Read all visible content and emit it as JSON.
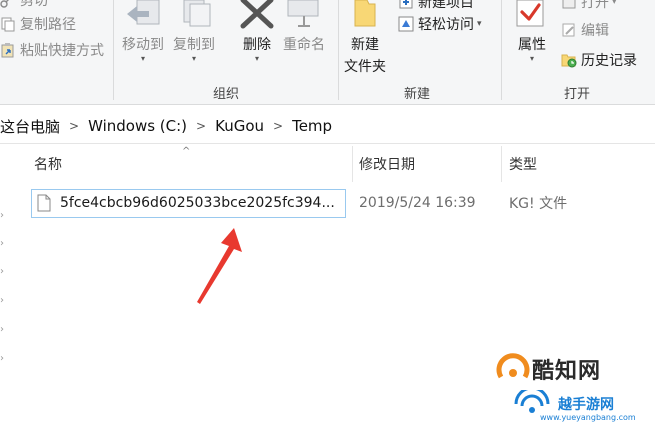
{
  "ribbon": {
    "clipboard": {
      "cut_label": "剪切",
      "copy_path_label": "复制路径",
      "paste_shortcut_label": "粘贴快捷方式"
    },
    "organize": {
      "move_to_label": "移动到",
      "copy_to_label": "复制到",
      "delete_label": "删除",
      "rename_label": "重命名",
      "group_label": "组织"
    },
    "new": {
      "new_folder_line1": "新建",
      "new_folder_line2": "文件夹",
      "new_item_label": "新建项目",
      "easy_access_label": "轻松访问",
      "group_label": "新建"
    },
    "open": {
      "properties_label": "属性",
      "open_label": "打开",
      "edit_label": "编辑",
      "history_label": "历史记录",
      "group_label": "打开"
    }
  },
  "address": {
    "crumbs": [
      "这台电脑",
      "Windows (C:)",
      "KuGou",
      "Temp"
    ]
  },
  "columns": {
    "name": "名称",
    "date": "修改日期",
    "type": "类型"
  },
  "files": [
    {
      "name": "5fce4cbcb96d6025033bce2025fc394...",
      "date": "2019/5/24 16:39",
      "type": "KG! 文件"
    }
  ],
  "watermark": {
    "brand": "酷知网",
    "site_name": "越手游网",
    "site_url": "www.yueyangbang.com"
  },
  "colors": {
    "selection_border": "#99c9ef",
    "arrow": "#e8392f",
    "folder": "#f8d775",
    "delete_x": "#555555"
  }
}
